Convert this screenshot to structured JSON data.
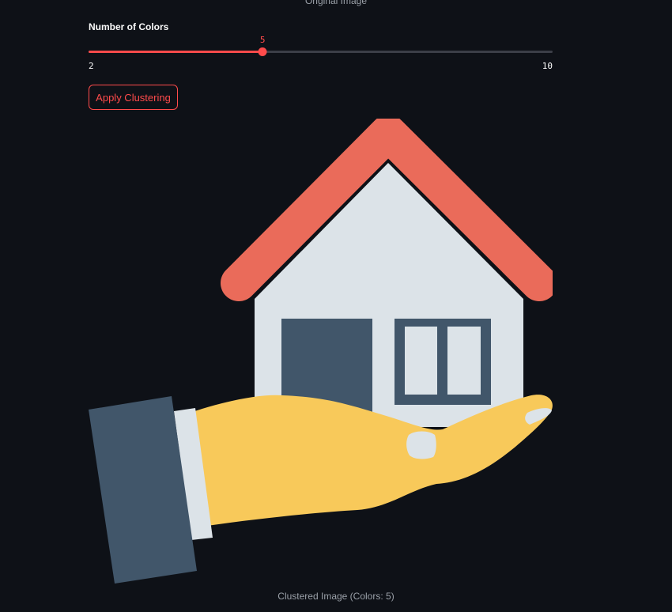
{
  "top_caption": "Original Image",
  "slider": {
    "label": "Number of Colors",
    "value": 5,
    "value_text": "5",
    "min": 2,
    "min_text": "2",
    "max": 10,
    "max_text": "10"
  },
  "apply_button": {
    "label": "Apply Clustering"
  },
  "image": {
    "palette": {
      "roof": "#ea6b5a",
      "wall": "#dce3e8",
      "slate": "#41566a",
      "hand": "#f8c95a",
      "background": "#0e1117"
    }
  },
  "bottom_caption": "Clustered Image (Colors: 5)",
  "colors": {
    "accent": "#ff4b4b",
    "page_background": "#0e1117",
    "track": "#3b3e47"
  }
}
